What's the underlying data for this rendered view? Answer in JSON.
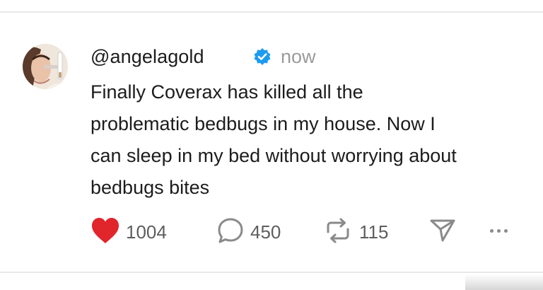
{
  "post": {
    "username": "@angelagold",
    "timestamp": "now",
    "text": "Finally Coverax has killed all the\nproblematic bedbugs in my house. Now I\ncan sleep in my bed without worrying about\nbedbugs bites",
    "stats": {
      "likes": "1004",
      "replies": "450",
      "reposts": "115"
    },
    "liked": true
  },
  "icons": {
    "avatar": "avatar",
    "verified": "verified-badge-icon",
    "like": "heart-icon",
    "reply": "comment-bubble-icon",
    "repost": "repost-icon",
    "share": "send-icon",
    "more": "more-horizontal-icon"
  },
  "colors": {
    "like": "#e0252b",
    "verified": "#1d9bf0",
    "muted_text": "#9b9b9b",
    "icon_gray": "#8a8a8a"
  }
}
